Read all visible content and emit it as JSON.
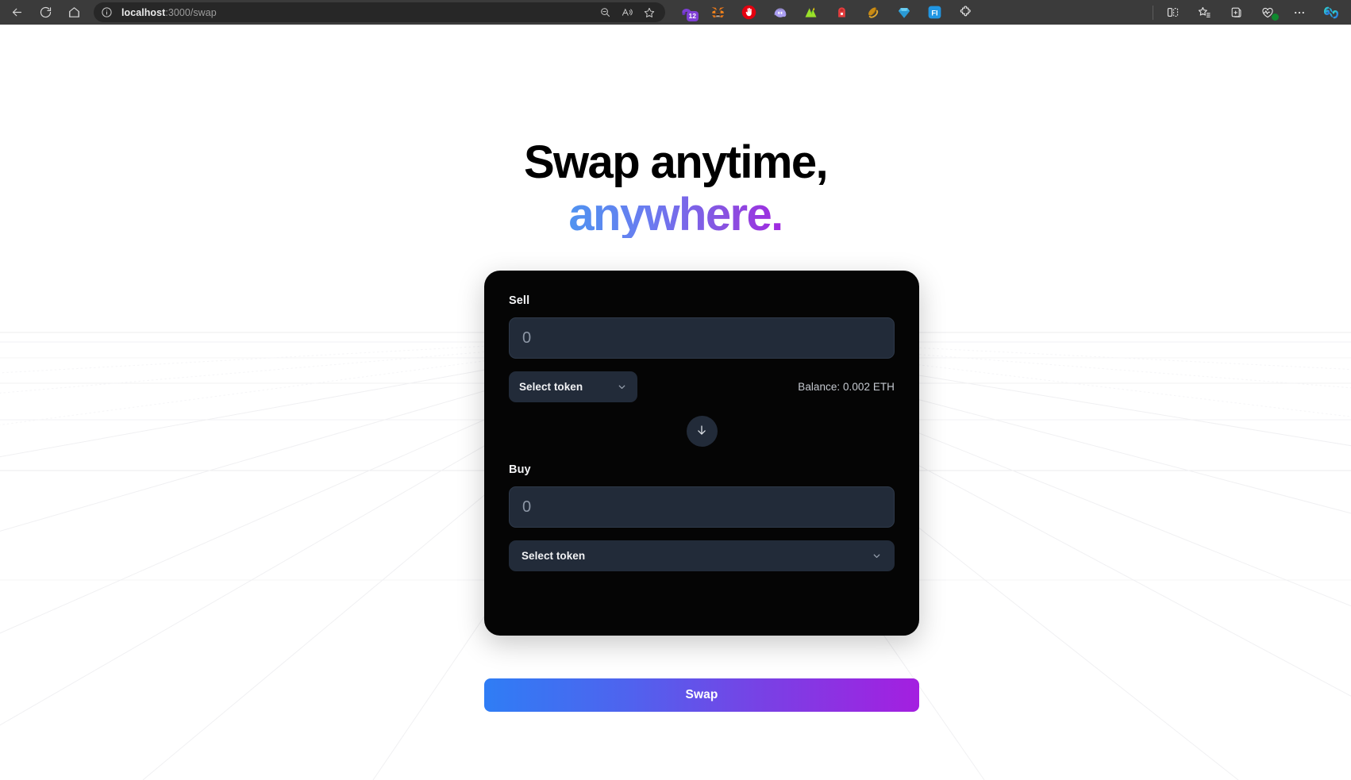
{
  "browser": {
    "nav": {
      "back_label": "Back",
      "refresh_label": "Refresh",
      "home_label": "Home"
    },
    "url": {
      "host": "localhost",
      "path": ":3000/swap",
      "info_icon": "info-circle-icon"
    },
    "url_right_icons": [
      {
        "name": "zoom-out-icon"
      },
      {
        "name": "read-aloud-icon"
      },
      {
        "name": "add-favorite-star-icon"
      }
    ],
    "extensions": [
      {
        "name": "rabby-wallet-icon",
        "badge": "12"
      },
      {
        "name": "metamask-icon"
      },
      {
        "name": "stop-hand-icon"
      },
      {
        "name": "phantom-wallet-icon"
      },
      {
        "name": "rainbow-wallet-icon"
      },
      {
        "name": "backpack-wallet-icon"
      },
      {
        "name": "sushiswap-icon"
      },
      {
        "name": "diamond-icon"
      },
      {
        "name": "fi-extension-icon"
      },
      {
        "name": "extensions-puzzle-icon"
      }
    ],
    "right_icons": [
      {
        "name": "split-screen-icon"
      },
      {
        "name": "favorites-icon"
      },
      {
        "name": "collections-icon"
      },
      {
        "name": "browser-essentials-icon"
      },
      {
        "name": "settings-more-icon"
      },
      {
        "name": "copilot-icon"
      }
    ]
  },
  "hero": {
    "line1": "Swap anytime,",
    "line2": "anywhere.",
    "gradient_from": "#4f93f0",
    "gradient_to": "#a128e0"
  },
  "swap": {
    "card_bg": "#050505",
    "sell": {
      "label": "Sell",
      "amount_value": "",
      "amount_placeholder": "0",
      "token_label": "Select token",
      "chevron_icon": "chevron-down-icon",
      "balance_text": "Balance: 0.002 ETH"
    },
    "switch": {
      "icon": "arrow-down-icon",
      "aria_label": "Switch tokens"
    },
    "buy": {
      "label": "Buy",
      "amount_value": "",
      "amount_placeholder": "0",
      "token_label": "Select token",
      "chevron_icon": "chevron-down-icon"
    },
    "cta": {
      "label": "Swap",
      "gradient_from": "#2f7df5",
      "gradient_to": "#a41fe0"
    }
  }
}
